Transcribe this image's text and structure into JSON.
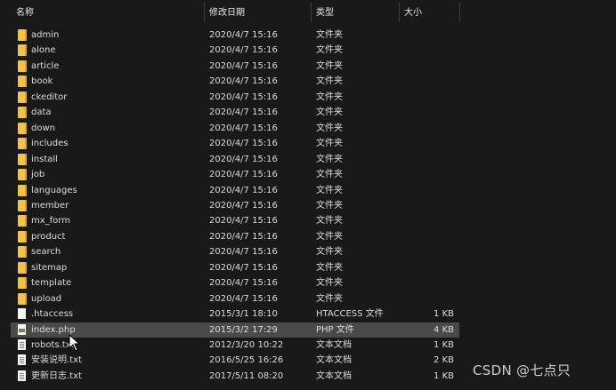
{
  "columns": {
    "name": "名称",
    "date": "修改日期",
    "type": "类型",
    "size": "大小"
  },
  "files": [
    {
      "name": "admin",
      "date": "2020/4/7 15:16",
      "type": "文件夹",
      "size": "",
      "icon": "folder-icon"
    },
    {
      "name": "alone",
      "date": "2020/4/7 15:16",
      "type": "文件夹",
      "size": "",
      "icon": "folder-icon"
    },
    {
      "name": "article",
      "date": "2020/4/7 15:16",
      "type": "文件夹",
      "size": "",
      "icon": "folder-icon"
    },
    {
      "name": "book",
      "date": "2020/4/7 15:16",
      "type": "文件夹",
      "size": "",
      "icon": "folder-icon"
    },
    {
      "name": "ckeditor",
      "date": "2020/4/7 15:16",
      "type": "文件夹",
      "size": "",
      "icon": "folder-icon"
    },
    {
      "name": "data",
      "date": "2020/4/7 15:16",
      "type": "文件夹",
      "size": "",
      "icon": "folder-icon"
    },
    {
      "name": "down",
      "date": "2020/4/7 15:16",
      "type": "文件夹",
      "size": "",
      "icon": "folder-icon"
    },
    {
      "name": "includes",
      "date": "2020/4/7 15:16",
      "type": "文件夹",
      "size": "",
      "icon": "folder-icon"
    },
    {
      "name": "install",
      "date": "2020/4/7 15:16",
      "type": "文件夹",
      "size": "",
      "icon": "folder-icon"
    },
    {
      "name": "job",
      "date": "2020/4/7 15:16",
      "type": "文件夹",
      "size": "",
      "icon": "folder-icon"
    },
    {
      "name": "languages",
      "date": "2020/4/7 15:16",
      "type": "文件夹",
      "size": "",
      "icon": "folder-icon"
    },
    {
      "name": "member",
      "date": "2020/4/7 15:16",
      "type": "文件夹",
      "size": "",
      "icon": "folder-icon"
    },
    {
      "name": "mx_form",
      "date": "2020/4/7 15:16",
      "type": "文件夹",
      "size": "",
      "icon": "folder-icon"
    },
    {
      "name": "product",
      "date": "2020/4/7 15:16",
      "type": "文件夹",
      "size": "",
      "icon": "folder-icon"
    },
    {
      "name": "search",
      "date": "2020/4/7 15:16",
      "type": "文件夹",
      "size": "",
      "icon": "folder-icon"
    },
    {
      "name": "sitemap",
      "date": "2020/4/7 15:16",
      "type": "文件夹",
      "size": "",
      "icon": "folder-icon"
    },
    {
      "name": "template",
      "date": "2020/4/7 15:16",
      "type": "文件夹",
      "size": "",
      "icon": "folder-icon"
    },
    {
      "name": "upload",
      "date": "2020/4/7 15:16",
      "type": "文件夹",
      "size": "",
      "icon": "folder-icon"
    },
    {
      "name": ".htaccess",
      "date": "2015/3/1 18:10",
      "type": "HTACCESS 文件",
      "size": "1 KB",
      "icon": "file-icon"
    },
    {
      "name": "index.php",
      "date": "2015/3/2 17:29",
      "type": "PHP 文件",
      "size": "4 KB",
      "icon": "php-file-icon",
      "selected": true
    },
    {
      "name": "robots.txt",
      "date": "2012/3/20 10:22",
      "type": "文本文档",
      "size": "1 KB",
      "icon": "text-file-icon"
    },
    {
      "name": "安装说明.txt",
      "date": "2016/5/25 16:26",
      "type": "文本文档",
      "size": "2 KB",
      "icon": "text-file-icon"
    },
    {
      "name": "更新日志.txt",
      "date": "2017/5/11 08:20",
      "type": "文本文档",
      "size": "1 KB",
      "icon": "text-file-icon"
    }
  ],
  "watermark": "CSDN @七点只",
  "colors": {
    "background": "#191919",
    "selected_row": "#4a4a4a",
    "folder": "#f2c24a",
    "text": "#dcdcdc"
  }
}
